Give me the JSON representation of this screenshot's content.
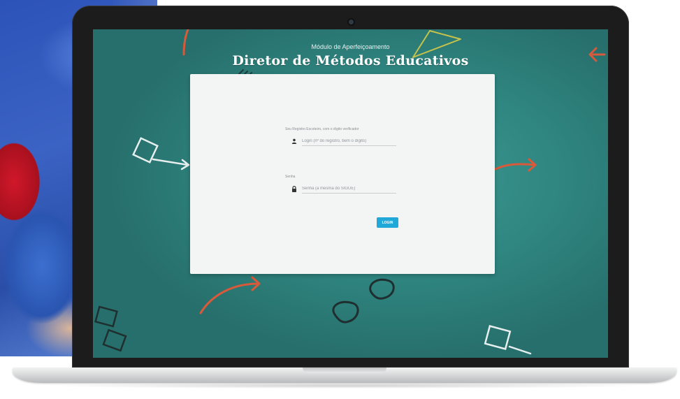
{
  "screen": {
    "module_subtitle": "Módulo de Aperfeiçoamento",
    "module_title": "Diretor de Métodos Educativos"
  },
  "login_form": {
    "username_label": "Seu Registro Escoteiro, com o dígito verificador",
    "username_placeholder": "Login (nº do registro, bem o dígito)",
    "password_label": "Senha",
    "password_placeholder": "Senha (a mesma do SIGUE)",
    "login_button_label": "LOGIN",
    "username_icon": "user-icon",
    "password_icon": "lock-icon"
  },
  "colors": {
    "screen_background": "#2f8580",
    "accent_button": "#1fa8d8",
    "doodle_red": "#d95a3a",
    "doodle_white": "#e6efee",
    "doodle_yellow": "#c7c24a"
  }
}
